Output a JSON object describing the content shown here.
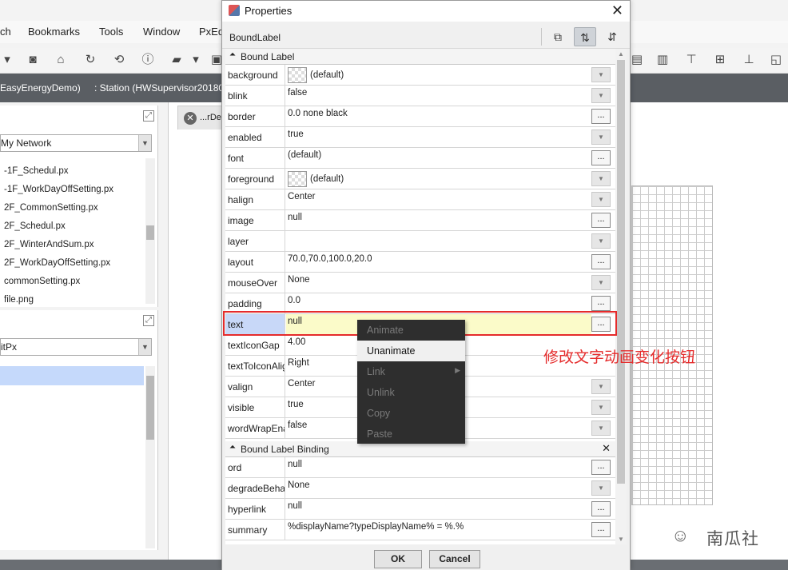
{
  "app": {
    "menu": [
      "ch",
      "Bookmarks",
      "Tools",
      "Window",
      "PxEd"
    ],
    "path": {
      "station_left": "EasyEnergyDemo)",
      "station_right": ":  Station (HWSupervisor20180"
    },
    "nav_combo": "My Network",
    "files": [
      "-1F_Schedul.px",
      "-1F_WorkDayOffSetting.px",
      "2F_CommonSetting.px",
      "2F_Schedul.px",
      "2F_WinterAndSum.px",
      "2F_WorkDayOffSetting.px",
      "commonSetting.px",
      "file.png"
    ],
    "type_combo": "itPx",
    "editor_tab": "...rDet"
  },
  "dialog": {
    "title": "Properties",
    "object_name": "BoundLabel",
    "sections": [
      {
        "title": "Bound Label"
      },
      {
        "title": "Bound Label Binding"
      }
    ],
    "properties": [
      {
        "name": "background",
        "value": "(default)",
        "swatch": true,
        "control": "dropdown"
      },
      {
        "name": "blink",
        "value": "false",
        "control": "dropdown"
      },
      {
        "name": "border",
        "value": "0.0 none black",
        "control": "ellipsis"
      },
      {
        "name": "enabled",
        "value": "true",
        "control": "dropdown"
      },
      {
        "name": "font",
        "value": "(default)",
        "control": "ellipsis"
      },
      {
        "name": "foreground",
        "value": "(default)",
        "swatch": true,
        "control": "dropdown"
      },
      {
        "name": "halign",
        "value": "Center",
        "control": "dropdown"
      },
      {
        "name": "image",
        "value": "null",
        "control": "ellipsis"
      },
      {
        "name": "layer",
        "value": "",
        "control": "dropdown"
      },
      {
        "name": "layout",
        "value": "70.0,70.0,100.0,20.0",
        "control": "ellipsis"
      },
      {
        "name": "mouseOver",
        "value": "None",
        "control": "dropdown"
      },
      {
        "name": "padding",
        "value": "0.0",
        "control": "ellipsis"
      },
      {
        "name": "text",
        "value": "null",
        "control": "ellipsis",
        "highlight": true
      },
      {
        "name": "textIconGap",
        "value": "4.00",
        "control": "none"
      },
      {
        "name": "textToIconAlig",
        "value": "Right",
        "control": "none"
      },
      {
        "name": "valign",
        "value": "Center",
        "control": "dropdown"
      },
      {
        "name": "visible",
        "value": "true",
        "control": "dropdown"
      },
      {
        "name": "wordWrapEna",
        "value": "false",
        "control": "dropdown"
      }
    ],
    "binding_properties": [
      {
        "name": "ord",
        "value": "null",
        "control": "ellipsis"
      },
      {
        "name": "degradeBehav",
        "value": "None",
        "control": "dropdown"
      },
      {
        "name": "hyperlink",
        "value": "null",
        "control": "ellipsis"
      },
      {
        "name": "summary",
        "value": "%displayName?typeDisplayName% = %.%",
        "control": "ellipsis"
      }
    ],
    "ok_label": "OK",
    "cancel_label": "Cancel"
  },
  "context_menu": {
    "items": [
      {
        "label": "Animate",
        "enabled": false
      },
      {
        "label": "Unanimate",
        "enabled": true,
        "hover": true
      },
      {
        "label": "Link",
        "enabled": false,
        "submenu": true
      },
      {
        "label": "Unlink",
        "enabled": false
      },
      {
        "label": "Copy",
        "enabled": false
      },
      {
        "label": "Paste",
        "enabled": false
      }
    ]
  },
  "annotation": {
    "label": "修改文字动画变化按钮",
    "color": "#e52b2b"
  },
  "watermark": {
    "text": "南瓜社"
  }
}
